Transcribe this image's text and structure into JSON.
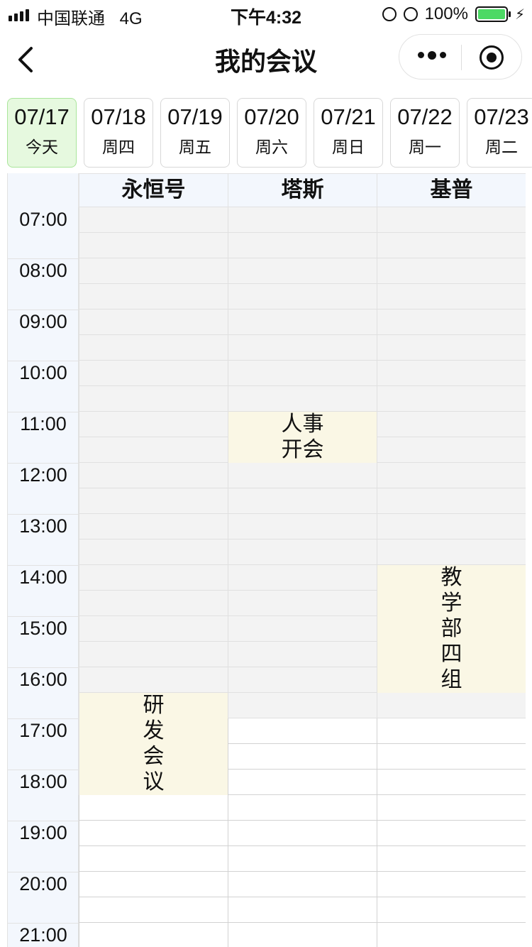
{
  "status_bar": {
    "carrier": "中国联通",
    "network": "4G",
    "time": "下午4:32",
    "battery_percent": "100%",
    "battery_level": 1.0,
    "icons": [
      "signal-icon",
      "orientation-lock-icon",
      "alarm-icon",
      "battery-icon",
      "charging-icon"
    ]
  },
  "nav": {
    "title": "我的会议",
    "icons": [
      "back-chevron-icon",
      "more-dots-icon",
      "close-target-icon"
    ]
  },
  "dates": [
    {
      "date": "07/17",
      "weekday": "今天",
      "active": true
    },
    {
      "date": "07/18",
      "weekday": "周四",
      "active": false
    },
    {
      "date": "07/19",
      "weekday": "周五",
      "active": false
    },
    {
      "date": "07/20",
      "weekday": "周六",
      "active": false
    },
    {
      "date": "07/21",
      "weekday": "周日",
      "active": false
    },
    {
      "date": "07/22",
      "weekday": "周一",
      "active": false
    },
    {
      "date": "07/23",
      "weekday": "周二",
      "active": false
    }
  ],
  "rooms": [
    "永恒号",
    "塔斯",
    "基普"
  ],
  "times": [
    "07:00",
    "08:00",
    "09:00",
    "10:00",
    "11:00",
    "12:00",
    "13:00",
    "14:00",
    "15:00",
    "16:00",
    "17:00",
    "18:00",
    "19:00",
    "20:00",
    "21:00"
  ],
  "meetings": [
    {
      "room": 1,
      "title": "人事开会",
      "start": "11:00",
      "end": "12:00"
    },
    {
      "room": 2,
      "title": "教学部四组",
      "start": "14:00",
      "end": "16:30"
    },
    {
      "room": 0,
      "title": "研发会议",
      "start": "16:30",
      "end": "18:30"
    }
  ],
  "booked_until": "17:00",
  "colors": {
    "accent_today": "#e6f9df",
    "header_bg": "#f3f7fd",
    "meeting_bg": "#faf7e5",
    "booked_bg": "#f3f3f3",
    "battery_green": "#4cd964"
  }
}
